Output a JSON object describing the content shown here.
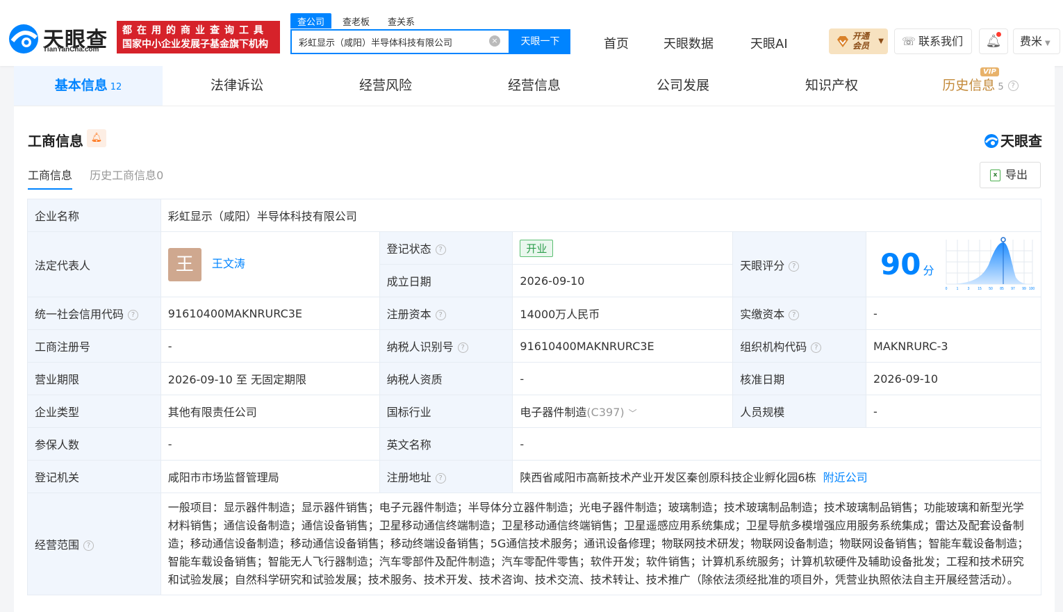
{
  "header": {
    "logo_text": "天眼查",
    "logo_sub": "TianYanCha.com",
    "banner_line1": "都在用的商业查询工具",
    "banner_line2": "国家中小企业发展子基金旗下机构",
    "search_tabs": [
      "查公司",
      "查老板",
      "查关系"
    ],
    "search_value": "彩虹显示（咸阳）半导体科技有限公司",
    "search_button": "天眼一下",
    "nav": [
      "首页",
      "天眼数据",
      "天眼AI"
    ],
    "vip_line1": "开通",
    "vip_line2": "会员",
    "contact": "联系我们",
    "user": "费米"
  },
  "tabs": [
    {
      "label": "基本信息",
      "count": "12"
    },
    {
      "label": "法律诉讼"
    },
    {
      "label": "经营风险"
    },
    {
      "label": "经营信息"
    },
    {
      "label": "公司发展"
    },
    {
      "label": "知识产权"
    },
    {
      "label": "历史信息",
      "count": "5",
      "badge": "VIP"
    }
  ],
  "section": {
    "title": "工商信息",
    "brand": "天眼查",
    "subtabs": [
      "工商信息",
      "历史工商信息0"
    ],
    "export": "导出"
  },
  "info": {
    "company_name_label": "企业名称",
    "company_name": "彩虹显示（咸阳）半导体科技有限公司",
    "legal_rep_label": "法定代表人",
    "legal_rep_avatar": "王",
    "legal_rep": "王文涛",
    "status_label": "登记状态",
    "status": "开业",
    "found_date_label": "成立日期",
    "found_date": "2026-09-10",
    "score_label": "天眼评分",
    "score": "90",
    "score_unit": "分",
    "score_axis": [
      "0",
      "1",
      "3",
      "15",
      "50",
      "85",
      "97",
      "99",
      "100"
    ],
    "credit_code_label": "统一社会信用代码",
    "credit_code": "91610400MAKNRURC3E",
    "reg_capital_label": "注册资本",
    "reg_capital": "14000万人民币",
    "paid_capital_label": "实缴资本",
    "paid_capital": "-",
    "reg_no_label": "工商注册号",
    "reg_no": "-",
    "taxpayer_id_label": "纳税人识别号",
    "taxpayer_id": "91610400MAKNRURC3E",
    "org_code_label": "组织机构代码",
    "org_code": "MAKNRURC-3",
    "term_label": "营业期限",
    "term": "2026-09-10 至 无固定期限",
    "taxpayer_qual_label": "纳税人资质",
    "taxpayer_qual": "-",
    "approve_date_label": "核准日期",
    "approve_date": "2026-09-10",
    "type_label": "企业类型",
    "type": "其他有限责任公司",
    "industry_label": "国标行业",
    "industry": "电子器件制造",
    "industry_code": "(C397)",
    "staff_size_label": "人员规模",
    "staff_size": "-",
    "insured_label": "参保人数",
    "insured": "-",
    "english_name_label": "英文名称",
    "english_name": "-",
    "authority_label": "登记机关",
    "authority": "咸阳市市场监督管理局",
    "address_label": "注册地址",
    "address": "陕西省咸阳市高新技术产业开发区秦创原科技企业孵化园6栋",
    "nearby": "附近公司",
    "scope_label": "经营范围",
    "scope": "一般项目：显示器件制造；显示器件销售；电子元器件制造；半导体分立器件制造；光电子器件制造；玻璃制造；技术玻璃制品制造；技术玻璃制品销售；功能玻璃和新型光学材料销售；通信设备制造；通信设备销售；卫星移动通信终端制造；卫星移动通信终端销售；卫星遥感应用系统集成；卫星导航多模增强应用服务系统集成；雷达及配套设备制造；移动通信设备制造；移动通信设备销售；移动终端设备销售；5G通信技术服务；通讯设备修理；物联网技术研发；物联网设备制造；物联网设备销售；智能车载设备制造；智能车载设备销售；智能无人飞行器制造；汽车零部件及配件制造；汽车零配件零售；软件开发；软件销售；计算机系统服务；计算机软硬件及辅助设备批发；工程和技术研究和试验发展；自然科学研究和试验发展；技术服务、技术开发、技术咨询、技术交流、技术转让、技术推广（除依法须经批准的项目外，凭营业执照依法自主开展经营活动）。"
  },
  "colors": {
    "brand_blue": "#0084ff",
    "banner_red": "#d6222a",
    "label_bg": "#f1f6fd"
  }
}
